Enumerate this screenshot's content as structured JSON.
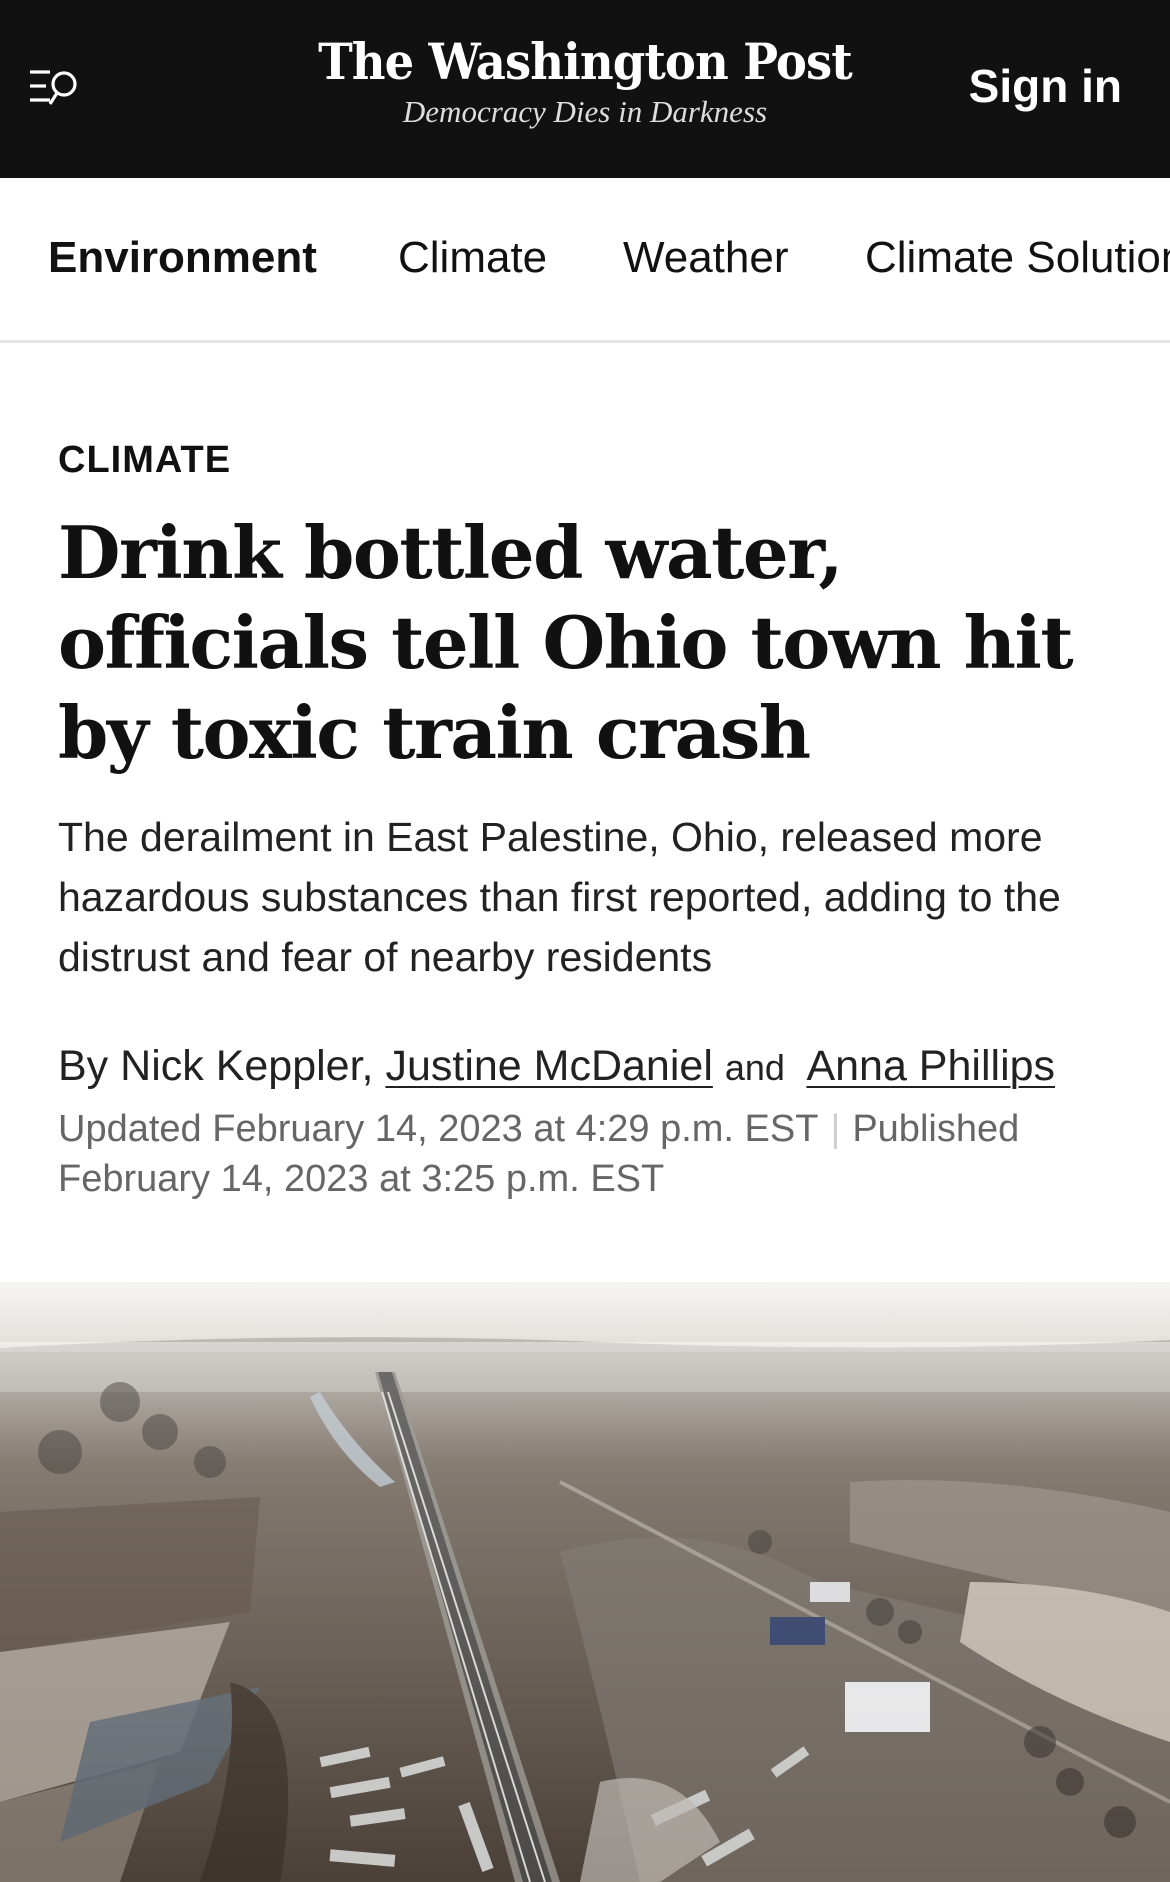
{
  "header": {
    "logo": "The Washington Post",
    "tagline": "Democracy Dies in Darkness",
    "menu_icon": "menu-search-icon",
    "sign_in_label": "Sign in",
    "background": "#111111"
  },
  "nav": {
    "items": [
      {
        "label": "Environment",
        "active": true
      },
      {
        "label": "Climate",
        "active": false
      },
      {
        "label": "Weather",
        "active": false
      },
      {
        "label": "Climate Solutions",
        "active": false
      }
    ]
  },
  "article": {
    "kicker": "CLIMATE",
    "headline": "Drink bottled water, officials tell Ohio town hit by toxic train crash",
    "dek": "The derailment in East Palestine, Ohio, released more hazardous substances than first reported, adding to the distrust and fear of nearby residents",
    "byline": {
      "prefix": "By",
      "authors": [
        "Nick Keppler",
        "Justine McDaniel",
        "Anna Phillips"
      ],
      "separator": ",",
      "conjunction": "and"
    },
    "updated": "Updated February 14, 2023 at 4:29 p.m. EST",
    "published": "Published February 14, 2023 at 3:25 p.m. EST",
    "image_subject": "aerial-photo-train-derailment"
  }
}
